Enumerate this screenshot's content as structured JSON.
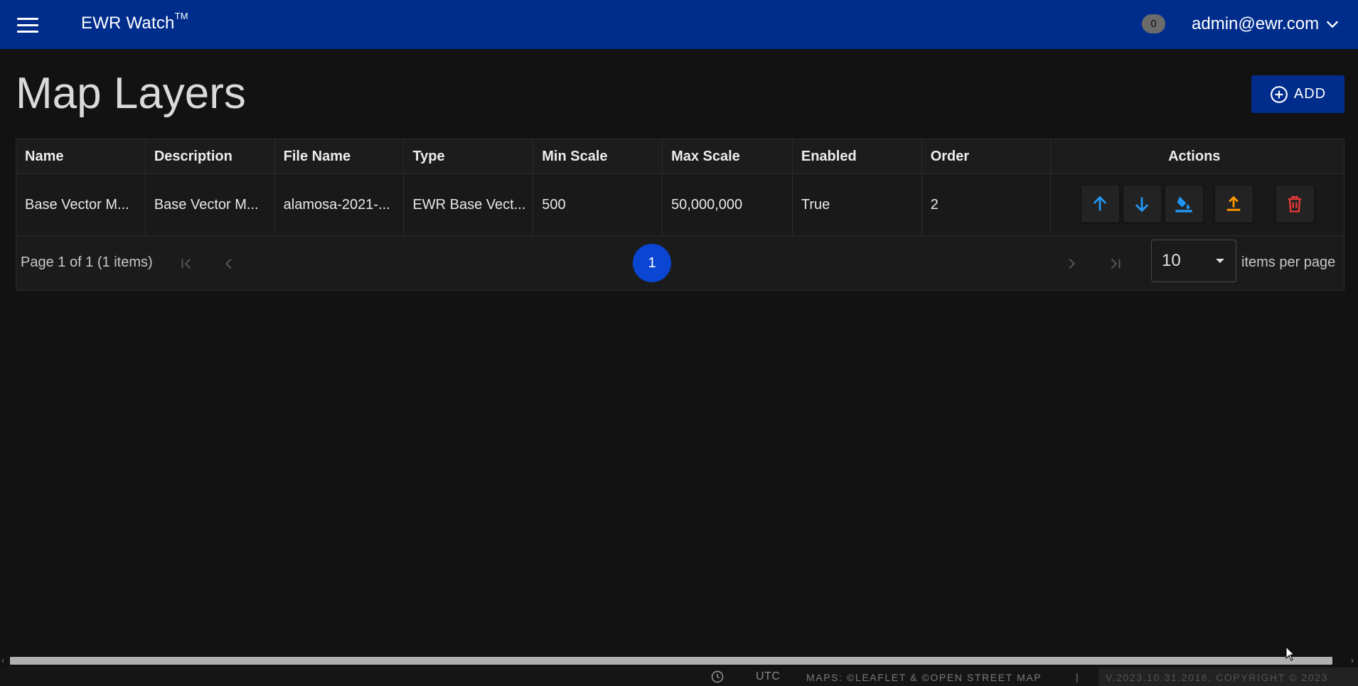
{
  "header": {
    "app_title": "EWR Watch",
    "trademark": "TM",
    "notification_count": "0",
    "user_email": "admin@ewr.com"
  },
  "page": {
    "title": "Map Layers",
    "add_label": "ADD"
  },
  "table": {
    "columns": [
      "Name",
      "Description",
      "File Name",
      "Type",
      "Min Scale",
      "Max Scale",
      "Enabled",
      "Order",
      "Actions"
    ],
    "rows": [
      [
        "Base Vector M...",
        "Base Vector M...",
        "alamosa-2021-...",
        "EWR Base Vect...",
        "500",
        "50,000,000",
        "True",
        "2"
      ]
    ],
    "action_icons": [
      "arrow-up-icon",
      "arrow-down-icon",
      "fill-color-icon",
      "upload-icon",
      "trash-icon"
    ]
  },
  "pager": {
    "info": "Page 1 of 1 (1 items)",
    "current_page": "1",
    "page_size": "10",
    "items_per_page_label": "items per page"
  },
  "footer": {
    "timezone": "UTC",
    "maps_credit": "MAPS: ©LEAFLET & ©OPEN STREET MAP",
    "separator": "|",
    "version": "V.2023.10.31.2016, COPYRIGHT © 2023"
  },
  "colors": {
    "header_bg": "#002d8c",
    "page_bg": "#121212",
    "accent_blue": "#0a46d2",
    "icon_blue": "#2196f3",
    "icon_orange": "#ff9800",
    "icon_red": "#e53935"
  }
}
